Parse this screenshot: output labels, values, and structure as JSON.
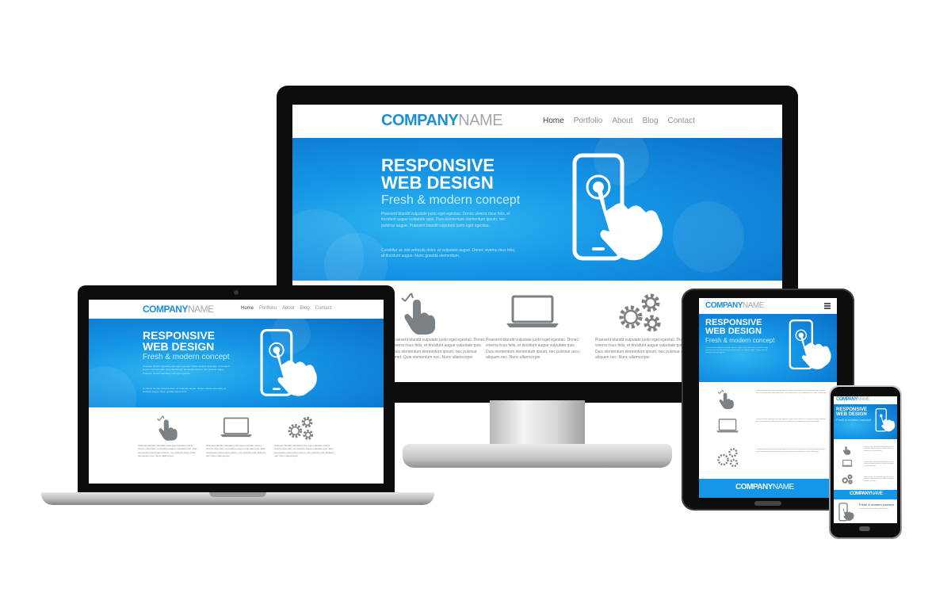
{
  "brand": {
    "company": "COMPANY",
    "name": "NAME"
  },
  "nav": [
    "Home",
    "Portfolio",
    "About",
    "Blog",
    "Contact"
  ],
  "hero": {
    "title_line1": "RESPONSIVE",
    "title_line2": "WEB DESIGN",
    "subtitle": "Fresh & modern concept",
    "para1": "Praesent blandit vulputate justo eget egestas. Donec viverra risus felis, et tincidunt augue vulputate quis. Duis elementum elementum ipsum, nec pulvinar augue. Praesent blandit vulputate justo eget egestas.",
    "para2": "Curabitur ac nisi vehicula dolor, at vulputate augue. Donec viverra risus felis, et tincidunt augue. Nunc gravida elementum."
  },
  "features": [
    {
      "icon": "touch-hand-icon",
      "text": "Praesent blandit vulputate justo eget egestas. Donec viverra risus felis, et tincidunt augue vulputate quis. Duis elementum elementum ipsum, nec pulvinar amet. Quis elementum nec. Nunc ullamcorper"
    },
    {
      "icon": "laptop-icon",
      "text": "Praesent blandit vulputate justo eget egestas. Donec viverra risus felis, et tincidunt augue vulputate quis. Duis elementum elementum ipsum, nec pulvinar arcu aliquam nec. Nunc ullamcorper"
    },
    {
      "icon": "gears-icon",
      "text": "Praesent blandit vulputate justo eget egestas. Donec viverra risus felis, et tincidunt augue vulputate quis. Duis elementum elementum ipsum, nec pulvinar arcu aliquam nec. Nunc ullamcorper"
    }
  ],
  "colors": {
    "accent": "#1b8fd6",
    "hero": "#1596e6",
    "frame": "#0d0d0d",
    "icon_gray": "#7c8186"
  }
}
